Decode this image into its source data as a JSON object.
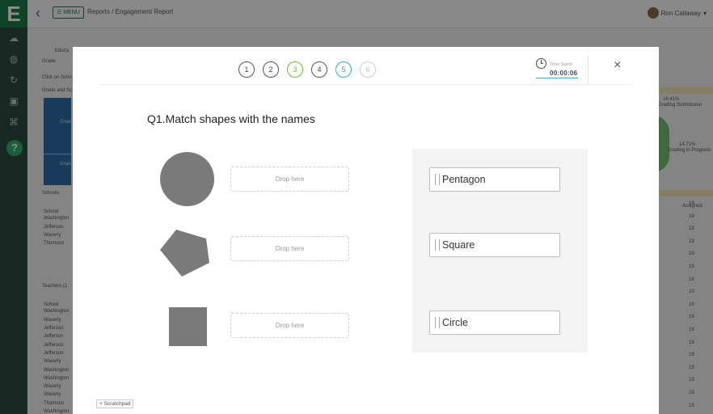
{
  "app": {
    "logo_letter": "E",
    "menu_label": "☰ MENU",
    "breadcrumb": "Reports / Engagement Report",
    "user_name": "Ron Callaway",
    "help_label": "?"
  },
  "background": {
    "labels": [
      "Educa",
      "Grade",
      "Click on Scho",
      "Grade and Sc",
      "Grade",
      "Grade",
      "Schools",
      "School",
      "Washington",
      "Jefferson",
      "Waverly",
      "Thomson",
      "Teachers (1",
      "School",
      "Washington",
      "Waverly",
      "Jefferson",
      "Jefferson",
      "Jefferson",
      "Jefferson",
      "Waverly",
      "Washington",
      "Washington",
      "Waverly",
      "Waverly",
      "Thomson",
      "Washington"
    ],
    "pie_labels": [
      "16.41%",
      "Grading Submission",
      "14.71%",
      "Grading in Progress"
    ],
    "right_header": "Assigned",
    "right_values": [
      "19",
      "19",
      "19",
      "19",
      "19",
      "19",
      "19",
      "19",
      "19",
      "19",
      "19",
      "19",
      "19",
      "19",
      "19",
      "19",
      "19",
      "19"
    ]
  },
  "quiz": {
    "steps": [
      {
        "label": "1",
        "state": "default"
      },
      {
        "label": "2",
        "state": "default"
      },
      {
        "label": "3",
        "state": "done"
      },
      {
        "label": "4",
        "state": "default"
      },
      {
        "label": "5",
        "state": "active"
      },
      {
        "label": "6",
        "state": "future"
      }
    ],
    "timer": {
      "label": "Time Spent",
      "value": "00:00:06"
    },
    "close_icon": "×",
    "question": "Q1.Match shapes with the names",
    "shapes": [
      "circle",
      "pentagon",
      "square"
    ],
    "drop_placeholder": "Drop here",
    "options": [
      "Pentagon",
      "Square",
      "Circle"
    ],
    "scratchpad_label": "+ Scratchpad",
    "colors": {
      "shape_fill": "#7a7a7a",
      "step_done": "#6abf2e",
      "step_active": "#2ea8d8"
    }
  }
}
